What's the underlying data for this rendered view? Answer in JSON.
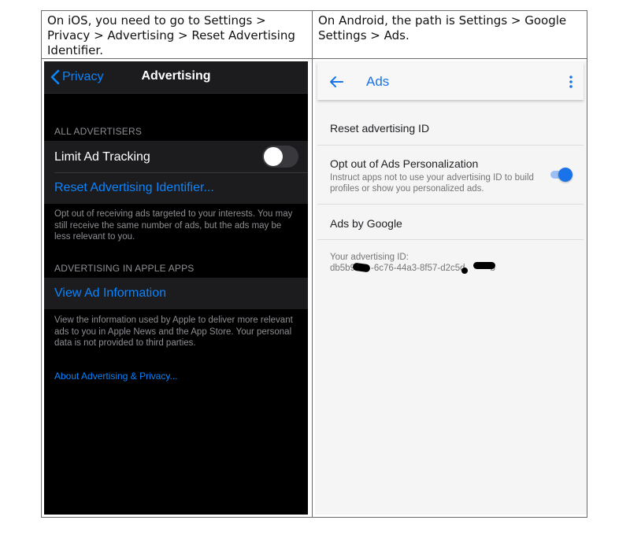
{
  "captions": {
    "ios": "On iOS, you need to go to Settings > Privacy > Advertising > Reset Advertising Identifier.",
    "android": "On Android, the path is Settings > Google Settings > Ads."
  },
  "ios": {
    "nav": {
      "back_label": "Privacy",
      "title": "Advertising"
    },
    "section_all_advertisers": "ALL ADVERTISERS",
    "limit_ad_tracking": {
      "label": "Limit Ad Tracking",
      "enabled": false
    },
    "reset_identifier": "Reset Advertising Identifier...",
    "footer_opt_out": "Opt out of receiving ads targeted to your interests. You may still receive the same number of ads, but the ads may be less relevant to you.",
    "section_apple_apps": "ADVERTISING IN APPLE APPS",
    "view_ad_information": "View Ad Information",
    "footer_apple": "View the information used by Apple to deliver more relevant ads to you in Apple News and the App Store. Your personal data is not provided to third parties.",
    "about_link": "About Advertising & Privacy...",
    "colors": {
      "accent": "#0a84ff",
      "background": "#000000",
      "cell": "#1c1c1e"
    }
  },
  "android": {
    "appbar": {
      "title": "Ads",
      "back_icon": "arrow-left-icon",
      "menu_icon": "more-vert-icon"
    },
    "reset_id": "Reset advertising ID",
    "opt_out": {
      "title": "Opt out of Ads Personalization",
      "description": "Instruct apps not to use your advertising ID to build profiles or show you personalized ads.",
      "enabled": true
    },
    "ads_by_google": "Ads by Google",
    "advertising_id": {
      "label": "Your advertising ID:",
      "value_part1": "db5b9",
      "value_part2": "-6c76-44a3-8f57-d2c5d",
      "value_part3": "b"
    },
    "colors": {
      "accent": "#1a73e8",
      "background": "#f5f5f5"
    }
  }
}
